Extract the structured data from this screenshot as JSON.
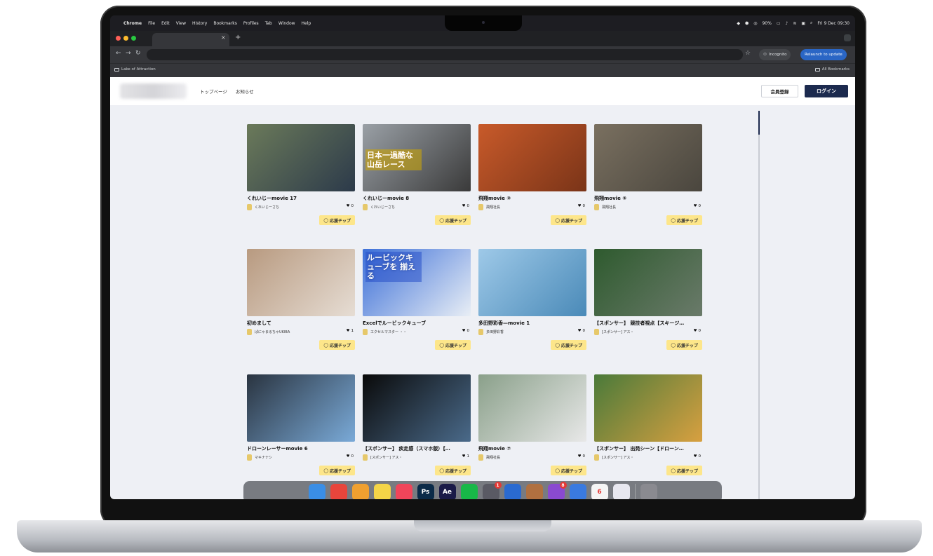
{
  "menubar": {
    "app": "Chrome",
    "items": [
      "File",
      "Edit",
      "View",
      "History",
      "Bookmarks",
      "Profiles",
      "Tab",
      "Window",
      "Help"
    ],
    "battery": "90%",
    "clock": "Fri 9 Dec 09:30"
  },
  "chrome": {
    "incognito_label": "Incognito",
    "relaunch_label": "Relaunch to update",
    "bookmark_left": "Lake of Attraction",
    "bookmark_right": "All Bookmarks"
  },
  "site": {
    "nav": [
      "トップページ",
      "お知らせ"
    ],
    "register_label": "会員登録",
    "login_label": "ログイン",
    "tip_label": "応援チップ",
    "cards": [
      {
        "title": "くれいじーmovie 17",
        "author": "くれいじーさち",
        "likes": "0",
        "colors": [
          "#6b7a5a",
          "#2c3a4a"
        ]
      },
      {
        "title": "くれいじーmovie 8",
        "author": "くれいじーさち",
        "likes": "0",
        "colors": [
          "#9aa0a6",
          "#3a3a3a"
        ]
      },
      {
        "title": "飛翔movie ②",
        "author": "飛翔社長",
        "likes": "0",
        "colors": [
          "#c85a2a",
          "#7a3418"
        ]
      },
      {
        "title": "飛翔movie ⑤",
        "author": "飛翔社長",
        "likes": "0",
        "colors": [
          "#7a7060",
          "#4a463e"
        ]
      },
      {
        "title": "初めまして",
        "author": "ぱにゃまるちゃUKIBA",
        "likes": "1",
        "colors": [
          "#b89a80",
          "#e6ddd4"
        ]
      },
      {
        "title": "Excelでルービックキューブ",
        "author": "エクセルマスター ・・",
        "likes": "0",
        "colors": [
          "#3c6fd8",
          "#e8eef5"
        ]
      },
      {
        "title": "多田野彩香—movie 1",
        "author": "多田野彩香",
        "likes": "0",
        "colors": [
          "#9ec9e8",
          "#4a8ab8"
        ]
      },
      {
        "title": "【スポンサー】 競技者視点【スキージ…",
        "author": "[スポンサー] アス・",
        "likes": "0",
        "colors": [
          "#2e5a2e",
          "#6a7a6a"
        ]
      },
      {
        "title": "ドローンレーサーmovie 6",
        "author": "マキナナシ",
        "likes": "0",
        "colors": [
          "#2a3440",
          "#7aaad8"
        ]
      },
      {
        "title": "【スポンサー】 疾走感（スマホ版）【…",
        "author": "[スポンサー] アス・",
        "likes": "1",
        "colors": [
          "#0a0a0a",
          "#4a6a8a"
        ]
      },
      {
        "title": "飛翔movie ⑦",
        "author": "飛翔社長",
        "likes": "0",
        "colors": [
          "#8aa08a",
          "#e8e8e8"
        ]
      },
      {
        "title": "【スポンサー】 出発シーン【ドローン…",
        "author": "[スポンサー] アス・",
        "likes": "0",
        "colors": [
          "#4a7a3a",
          "#d8a040"
        ]
      }
    ]
  },
  "thumbnail_overlays": {
    "card_1": "日本一過酷な 山岳レース",
    "card_5": "ルービックキューブを 揃える"
  },
  "dock": {
    "apps": [
      {
        "name": "finder",
        "color": "#3a8ee6",
        "label": ""
      },
      {
        "name": "chrome",
        "color": "#e8453c",
        "label": ""
      },
      {
        "name": "photos",
        "color": "#f0a030",
        "label": ""
      },
      {
        "name": "notes",
        "color": "#f5d547",
        "label": ""
      },
      {
        "name": "music",
        "color": "#f0455a",
        "label": ""
      },
      {
        "name": "photoshop",
        "color": "#0b2a48",
        "label": "Ps"
      },
      {
        "name": "after-effects",
        "color": "#1a1a48",
        "label": "Ae"
      },
      {
        "name": "line",
        "color": "#18b848",
        "label": ""
      },
      {
        "name": "app-gear",
        "color": "#5a5a64",
        "label": ""
      },
      {
        "name": "app-download",
        "color": "#2a6ad0",
        "label": ""
      },
      {
        "name": "app-book",
        "color": "#b07040",
        "label": ""
      },
      {
        "name": "app-puzzle",
        "color": "#8a4ad0",
        "label": ""
      },
      {
        "name": "app-monitor",
        "color": "#3a7ae0",
        "label": ""
      },
      {
        "name": "calendar",
        "color": "#f5f5f5",
        "label": "6"
      },
      {
        "name": "app-window",
        "color": "#e8e8f0",
        "label": ""
      },
      {
        "name": "trash",
        "color": "#8a8a90",
        "label": ""
      }
    ],
    "badges": {
      "app-gear": "1",
      "app-puzzle": "8"
    }
  }
}
